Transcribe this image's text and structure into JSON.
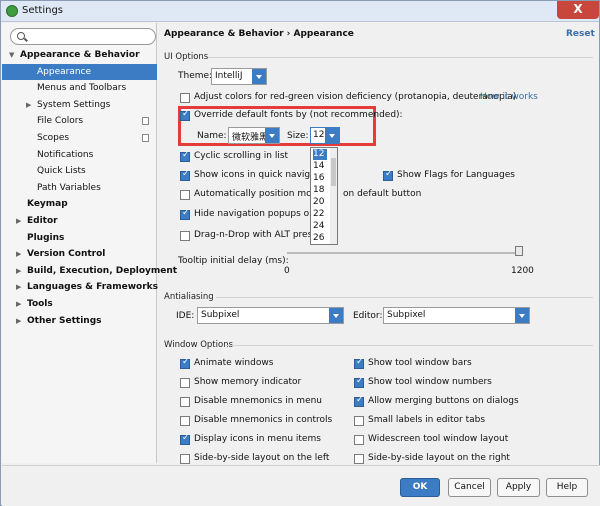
{
  "window": {
    "title": "Settings",
    "close_label": "X"
  },
  "search": {
    "placeholder": "",
    "icon": "search-icon"
  },
  "tree": [
    {
      "label": "Appearance & Behavior",
      "bold": true,
      "arrow": "▼"
    },
    {
      "label": "Appearance",
      "selected": true
    },
    {
      "label": "Menus and Toolbars"
    },
    {
      "label": "System Settings",
      "arrow": "▶"
    },
    {
      "label": "File Colors",
      "page_icon": true
    },
    {
      "label": "Scopes",
      "page_icon": true
    },
    {
      "label": "Notifications"
    },
    {
      "label": "Quick Lists"
    },
    {
      "label": "Path Variables"
    },
    {
      "label": "Keymap",
      "bold": true
    },
    {
      "label": "Editor",
      "bold": true,
      "arrow": "▶"
    },
    {
      "label": "Plugins",
      "bold": true
    },
    {
      "label": "Version Control",
      "bold": true,
      "arrow": "▶"
    },
    {
      "label": "Build, Execution, Deployment",
      "bold": true,
      "arrow": "▶"
    },
    {
      "label": "Languages & Frameworks",
      "bold": true,
      "arrow": "▶"
    },
    {
      "label": "Tools",
      "bold": true,
      "arrow": "▶"
    },
    {
      "label": "Other Settings",
      "bold": true,
      "arrow": "▶"
    }
  ],
  "main": {
    "breadcrumb": "Appearance & Behavior › Appearance",
    "reset": "Reset",
    "ui_options": {
      "heading": "UI Options",
      "theme_label": "Theme:",
      "theme_value": "IntelliJ",
      "adjust_colors": "Adjust colors for red-green vision deficiency (protanopia, deuteranopia)",
      "how_it_works": "How it works",
      "override_fonts": "Override default fonts by (not recommended):",
      "name_label": "Name:",
      "name_value": "微软雅黑",
      "size_label": "Size:",
      "size_value": "12",
      "size_options": [
        "12",
        "14",
        "16",
        "18",
        "20",
        "22",
        "24",
        "26"
      ],
      "cyclic_scrolling": "Cyclic scrolling in list",
      "show_icons_quick_nav": "Show icons in quick navigatio",
      "auto_position_mouse": "Automatically position mouse",
      "auto_position_mouse_tail": "on default button",
      "hide_nav_popups": "Hide navigation popups on fo",
      "drag_n_drop": "Drag-n-Drop with ALT presse",
      "show_flags": "Show Flags for Languages",
      "tooltip_delay_label": "Tooltip initial delay (ms):",
      "tooltip_delay_min": "0",
      "tooltip_delay_max": "1200",
      "tooltip_delay_fraction": 0.99
    },
    "antialiasing": {
      "heading": "Antialiasing",
      "ide_label": "IDE:",
      "ide_value": "Subpixel",
      "editor_label": "Editor:",
      "editor_value": "Subpixel"
    },
    "window_options": {
      "heading": "Window Options",
      "left": [
        {
          "label": "Animate windows",
          "checked": true
        },
        {
          "label": "Show memory indicator",
          "checked": false
        },
        {
          "label": "Disable mnemonics in menu",
          "checked": false
        },
        {
          "label": "Disable mnemonics in controls",
          "checked": false
        },
        {
          "label": "Display icons in menu items",
          "checked": true
        },
        {
          "label": "Side-by-side layout on the left",
          "checked": false
        }
      ],
      "right": [
        {
          "label": "Show tool window bars",
          "checked": true
        },
        {
          "label": "Show tool window numbers",
          "checked": true
        },
        {
          "label": "Allow merging buttons on dialogs",
          "checked": true
        },
        {
          "label": "Small labels in editor tabs",
          "checked": false
        },
        {
          "label": "Widescreen tool window layout",
          "checked": false
        },
        {
          "label": "Side-by-side layout on the right",
          "checked": false
        }
      ]
    }
  },
  "buttons": {
    "ok": "OK",
    "cancel": "Cancel",
    "apply": "Apply",
    "help": "Help"
  },
  "colors": {
    "accent": "#3b7cc4",
    "highlight_box": "#e53b3b",
    "link": "#3b6ea5"
  }
}
